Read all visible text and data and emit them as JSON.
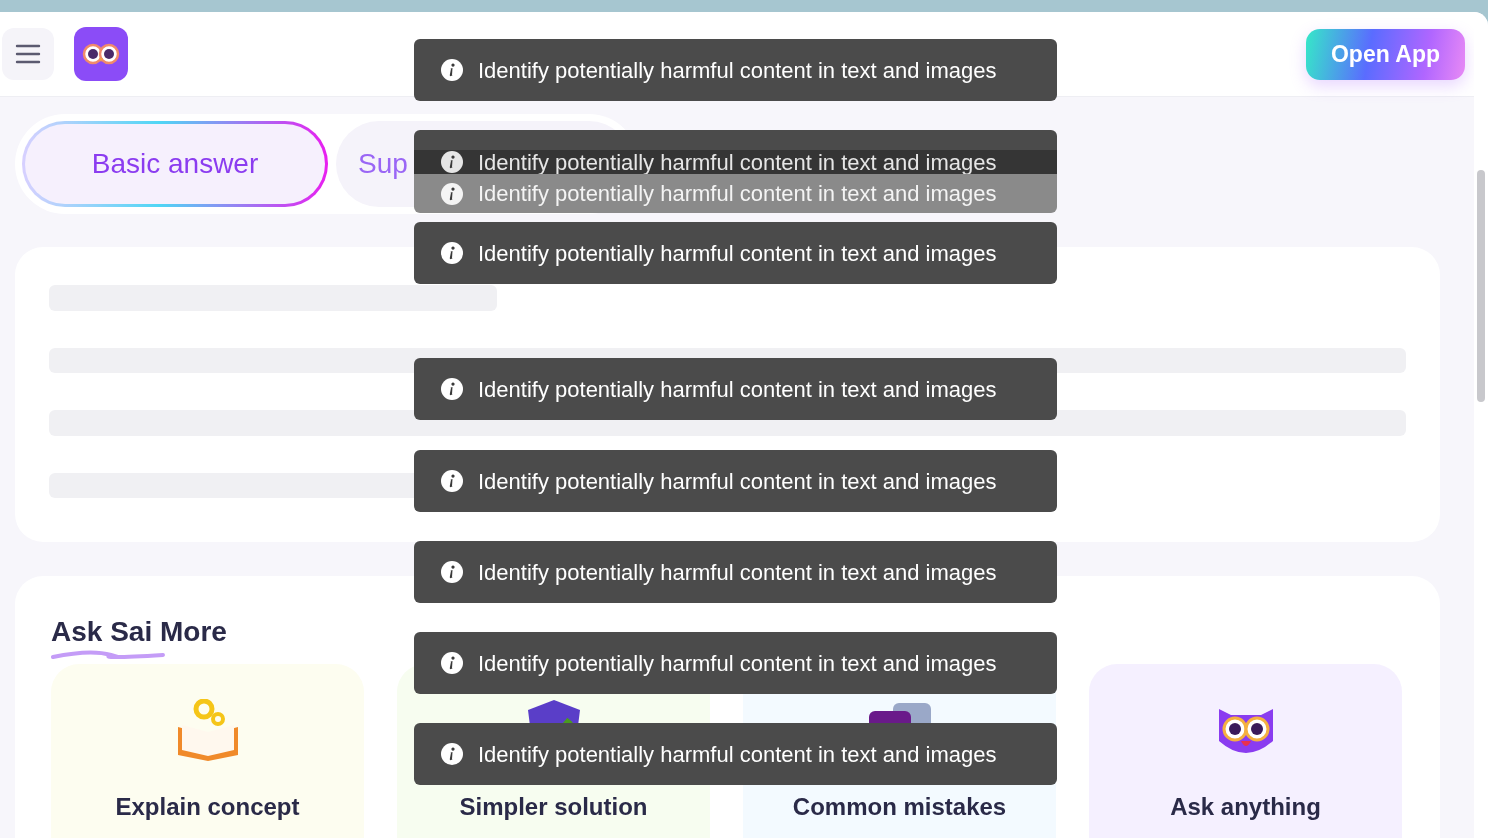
{
  "header": {
    "open_app": "Open App"
  },
  "tabs": [
    {
      "label": "Basic answer",
      "selected": true
    },
    {
      "label": "Sup",
      "selected": false
    }
  ],
  "ask_more": {
    "title": "Ask Sai More",
    "cards": [
      {
        "kind": "book",
        "label": "Explain concept"
      },
      {
        "kind": "shield",
        "label": "Simpler solution"
      },
      {
        "kind": "notes",
        "label": "Common mistakes"
      },
      {
        "kind": "owl",
        "label": "Ask anything"
      }
    ]
  },
  "toasts": [
    {
      "message": "Identify potentially harmful content in text and images",
      "kind": "solid"
    },
    {
      "message": "Identify potentially harmful content in text and images",
      "kind": "dim"
    },
    {
      "message": "Identify potentially harmful content in text and images",
      "kind": "faded"
    },
    {
      "message": "Identify potentially harmful content in text and images",
      "kind": "solid"
    },
    {
      "message": "Identify potentially harmful content in text and images",
      "kind": "solid"
    },
    {
      "message": "Identify potentially harmful content in text and images",
      "kind": "solid"
    },
    {
      "message": "Identify potentially harmful content in text and images",
      "kind": "solid"
    },
    {
      "message": "Identify potentially harmful content in text and images",
      "kind": "solid"
    },
    {
      "message": "Identify potentially harmful content in text and images",
      "kind": "solid"
    }
  ]
}
